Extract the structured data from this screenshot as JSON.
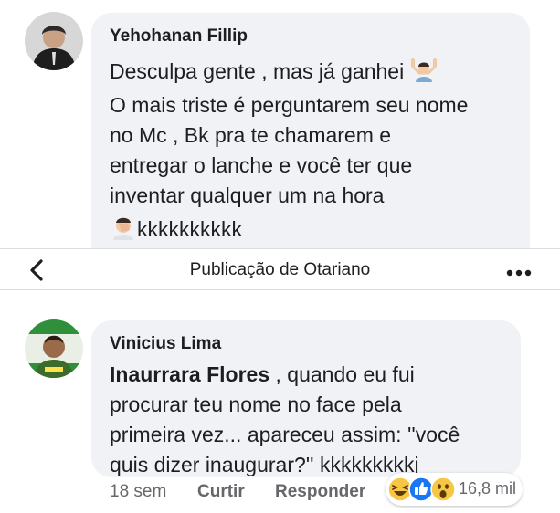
{
  "comment1": {
    "author": "Yehohanan Fillip",
    "lines": [
      "Desculpa gente , mas já ganhei",
      "O mais triste é perguntarem seu nome",
      "no Mc , Bk pra te chamarem e",
      "entregar o lanche e você ter que",
      "inventar qualquer um na hora"
    ],
    "laugh": "kkkkkkkkkk",
    "icons": [
      "person-raising-hands-emoji",
      "facepalm-emoji"
    ]
  },
  "navbar": {
    "title": "Publicação de Otariano",
    "back_icon": "chevron-left-icon",
    "more_icon": "ellipsis-icon"
  },
  "comment2": {
    "author": "Vinicius Lima",
    "mention": "Inaurrara Flores",
    "line1_rest": ", quando eu fui",
    "lines": [
      "procurar teu nome no face pela",
      "primeira vez... apareceu assim: ''você",
      "quis dizer inaugurar?'' kkkkkkkkkj"
    ],
    "time": "18 sem",
    "like_label": "Curtir",
    "reply_label": "Responder",
    "reactions": {
      "icons": [
        "haha-icon",
        "like-icon",
        "wow-icon"
      ],
      "count": "16,8 mil"
    }
  },
  "colors": {
    "bubble": "#f0f2f5",
    "secondary_text": "#65676b",
    "like_blue": "#1877f2",
    "reaction_yellow": "#f7c644"
  }
}
